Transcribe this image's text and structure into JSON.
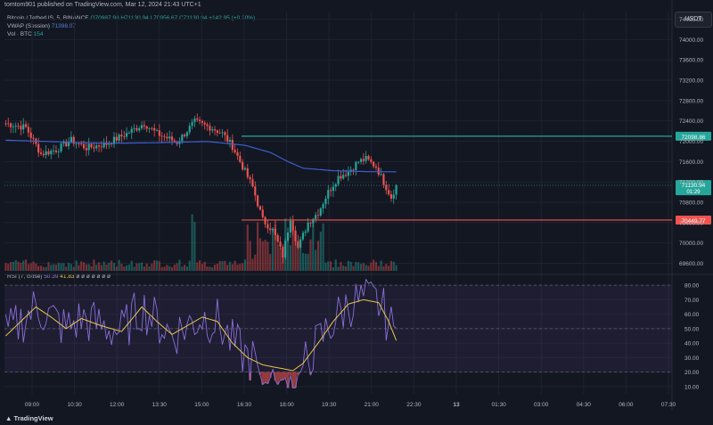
{
  "header": {
    "published_line": "tomtom901 published on TradingView.com, Mar 12, 2024 21:43 UTC+1"
  },
  "legend": {
    "symbol": "Bitcoin / TetherUS, 5, BINANCE",
    "ohlc": "O70987.98 H71130.94 L70956.67 C71130.94 +142.95 (+0.20%)",
    "vwap_label": "VWAP (Session)",
    "vwap_value": "71398.07",
    "vol_label": "Vol · BTC",
    "vol_value": "154",
    "rsi_label": "RSI (7, close)",
    "rsi_value": "50.39",
    "rsi_ma_value": "41.83",
    "rsi_extra": "ø ø ø ø ø ø ø"
  },
  "currency": "USDT",
  "brand": "TradingView",
  "colors": {
    "up": "#26a69a",
    "down": "#ef5350",
    "vwap": "#3d5fcc",
    "rsi": "#8a6fd6",
    "rsi_ma": "#e6c84a",
    "bg": "#131722"
  },
  "chart_data": [
    {
      "type": "candlestick",
      "title": "Bitcoin / TetherUS, 5, BINANCE",
      "price_ticks": [
        "74400.00",
        "74000.00",
        "73600.00",
        "73200.00",
        "72800.00",
        "72400.00",
        "72000.00",
        "71600.00",
        "71200.00",
        "70800.00",
        "70400.00",
        "70000.00",
        "69600.00"
      ],
      "price_ticks_num": [
        74400,
        74000,
        73600,
        73200,
        72800,
        72400,
        72000,
        71600,
        71200,
        70800,
        70400,
        70000,
        69600
      ],
      "ylim": [
        69450,
        74550
      ],
      "time_ticks": [
        "09:00",
        "10:30",
        "12:00",
        "13:30",
        "15:00",
        "16:30",
        "18:00",
        "19:30",
        "21:00",
        "22:30",
        "13",
        "01:30",
        "03:00",
        "04:30",
        "06:00",
        "07:30"
      ],
      "horizontal_lines": [
        {
          "price": 72098.86,
          "label": "72098.86",
          "color": "#26a69a",
          "from_time_index": 5
        },
        {
          "price": 70449.77,
          "label": "70449.77",
          "color": "#ef5350",
          "from_time_index": 5
        }
      ],
      "last_price": {
        "price": 71130.94,
        "label": "71130.94",
        "countdown": "01:29"
      },
      "anchors": [
        {
          "t": 0,
          "p": 72350
        },
        {
          "t": 8,
          "p": 72270
        },
        {
          "t": 14,
          "p": 71750
        },
        {
          "t": 20,
          "p": 71830
        },
        {
          "t": 26,
          "p": 72020
        },
        {
          "t": 32,
          "p": 71870
        },
        {
          "t": 40,
          "p": 71950
        },
        {
          "t": 48,
          "p": 72150
        },
        {
          "t": 55,
          "p": 72350
        },
        {
          "t": 60,
          "p": 72150
        },
        {
          "t": 68,
          "p": 71980
        },
        {
          "t": 75,
          "p": 72380
        },
        {
          "t": 82,
          "p": 72260
        },
        {
          "t": 86,
          "p": 72150
        },
        {
          "t": 90,
          "p": 71900
        },
        {
          "t": 94,
          "p": 71500
        },
        {
          "t": 98,
          "p": 71100
        },
        {
          "t": 102,
          "p": 70450
        },
        {
          "t": 106,
          "p": 70250
        },
        {
          "t": 110,
          "p": 69750
        },
        {
          "t": 113,
          "p": 70500
        },
        {
          "t": 116,
          "p": 69900
        },
        {
          "t": 120,
          "p": 70400
        },
        {
          "t": 124,
          "p": 70600
        },
        {
          "t": 128,
          "p": 71000
        },
        {
          "t": 132,
          "p": 71300
        },
        {
          "t": 136,
          "p": 71400
        },
        {
          "t": 140,
          "p": 71600
        },
        {
          "t": 143,
          "p": 71650
        },
        {
          "t": 147,
          "p": 71500
        },
        {
          "t": 150,
          "p": 71200
        },
        {
          "t": 153,
          "p": 70900
        },
        {
          "t": 155,
          "p": 71130.94
        }
      ],
      "vwap": [
        {
          "t": 0,
          "p": 72020
        },
        {
          "t": 20,
          "p": 71990
        },
        {
          "t": 40,
          "p": 71960
        },
        {
          "t": 60,
          "p": 71970
        },
        {
          "t": 80,
          "p": 71995
        },
        {
          "t": 95,
          "p": 71920
        },
        {
          "t": 105,
          "p": 71780
        },
        {
          "t": 112,
          "p": 71600
        },
        {
          "t": 118,
          "p": 71470
        },
        {
          "t": 130,
          "p": 71420
        },
        {
          "t": 145,
          "p": 71400
        },
        {
          "t": 155,
          "p": 71398.07
        }
      ],
      "candle_count": 156
    },
    {
      "type": "line",
      "title": "RSI (7, close)",
      "yticks": [
        "80.00",
        "70.00",
        "60.00",
        "50.00",
        "40.00",
        "30.00",
        "20.00",
        "10.00"
      ],
      "yticks_num": [
        80,
        70,
        60,
        50,
        40,
        30,
        20,
        10
      ],
      "ylim": [
        5,
        85
      ],
      "bands": [
        80,
        50,
        20
      ],
      "rsi_ma": [
        {
          "t": 0,
          "v": 45
        },
        {
          "t": 6,
          "v": 55
        },
        {
          "t": 12,
          "v": 65
        },
        {
          "t": 18,
          "v": 58
        },
        {
          "t": 24,
          "v": 50
        },
        {
          "t": 30,
          "v": 57
        },
        {
          "t": 38,
          "v": 52
        },
        {
          "t": 46,
          "v": 48
        },
        {
          "t": 54,
          "v": 65
        },
        {
          "t": 60,
          "v": 55
        },
        {
          "t": 66,
          "v": 46
        },
        {
          "t": 72,
          "v": 52
        },
        {
          "t": 78,
          "v": 58
        },
        {
          "t": 84,
          "v": 55
        },
        {
          "t": 90,
          "v": 40
        },
        {
          "t": 96,
          "v": 30
        },
        {
          "t": 102,
          "v": 25
        },
        {
          "t": 108,
          "v": 23
        },
        {
          "t": 114,
          "v": 21
        },
        {
          "t": 118,
          "v": 26
        },
        {
          "t": 124,
          "v": 40
        },
        {
          "t": 130,
          "v": 55
        },
        {
          "t": 136,
          "v": 67
        },
        {
          "t": 142,
          "v": 70
        },
        {
          "t": 148,
          "v": 68
        },
        {
          "t": 152,
          "v": 55
        },
        {
          "t": 155,
          "v": 41.83
        }
      ],
      "rsi_last": 50.39
    }
  ]
}
